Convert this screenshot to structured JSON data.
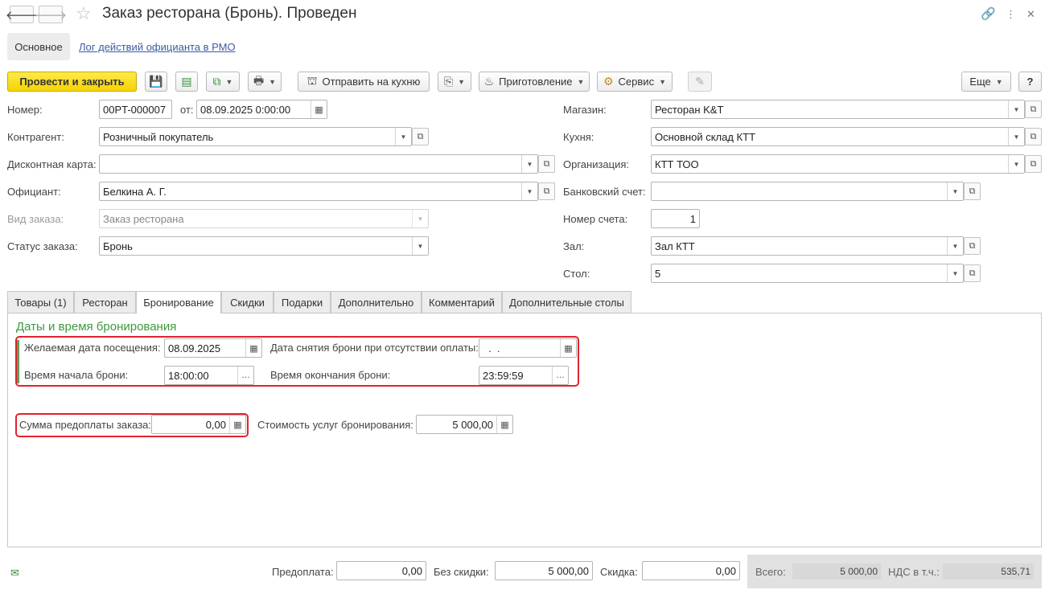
{
  "window": {
    "title": "Заказ ресторана (Бронь). Проведен"
  },
  "page_tabs": {
    "main": "Основное",
    "log_link": "Лог действий официанта в РМО"
  },
  "toolbar": {
    "post_close": "Провести и закрыть",
    "send_kitchen": "Отправить на кухню",
    "cooking": "Приготовление",
    "service": "Сервис",
    "more": "Еще",
    "help": "?"
  },
  "form": {
    "number_label": "Номер:",
    "number_value": "00PT-000007",
    "date_label": "от:",
    "date_value": "08.09.2025  0:00:00",
    "counterparty_label": "Контрагент:",
    "counterparty_value": "Розничный покупатель",
    "discount_card_label": "Дисконтная карта:",
    "discount_card_value": "",
    "waiter_label": "Официант:",
    "waiter_value": "Белкина А. Г.",
    "order_type_label": "Вид заказа:",
    "order_type_value": "Заказ ресторана",
    "status_label": "Статус заказа:",
    "status_value": "Бронь",
    "shop_label": "Магазин:",
    "shop_value": "Ресторан K&T",
    "kitchen_label": "Кухня:",
    "kitchen_value": "Основной склад КТТ",
    "org_label": "Организация:",
    "org_value": "КТТ ТОО",
    "bank_label": "Банковский счет:",
    "bank_value": "",
    "account_num_label": "Номер счета:",
    "account_num_value": "1",
    "hall_label": "Зал:",
    "hall_value": "Зал КТТ",
    "table_label": "Стол:",
    "table_value": "5"
  },
  "tabs": [
    {
      "label": "Товары (1)"
    },
    {
      "label": "Ресторан"
    },
    {
      "label": "Бронирование"
    },
    {
      "label": "Скидки"
    },
    {
      "label": "Подарки"
    },
    {
      "label": "Дополнительно"
    },
    {
      "label": "Комментарий"
    },
    {
      "label": "Дополнительные столы"
    }
  ],
  "booking": {
    "section_title": "Даты и время бронирования",
    "visit_date_label": "Желаемая дата посещения:",
    "visit_date_value": "08.09.2025",
    "cancel_date_label": "Дата снятия брони при отсутствии оплаты:",
    "cancel_date_value": "  .  .",
    "start_time_label": "Время начала брони:",
    "start_time_value": "18:00:00",
    "end_time_label": "Время окончания брони:",
    "end_time_value": "23:59:59",
    "prepay_label": "Сумма предоплаты заказа:",
    "prepay_value": "0,00",
    "service_cost_label": "Стоимость услуг бронирования:",
    "service_cost_value": "5 000,00"
  },
  "footer": {
    "prepayment_label": "Предоплата:",
    "prepayment_value": "0,00",
    "no_discount_label": "Без скидки:",
    "no_discount_value": "5 000,00",
    "discount_label": "Скидка:",
    "discount_value": "0,00",
    "total_label": "Всего:",
    "total_value": "5 000,00",
    "vat_label": "НДС в т.ч.:",
    "vat_value": "535,71"
  },
  "colors": {
    "primary_button": "#f5d300",
    "highlight_box": "#e3222e",
    "section_title": "#3c9a3c",
    "link": "#3a5ba0"
  }
}
